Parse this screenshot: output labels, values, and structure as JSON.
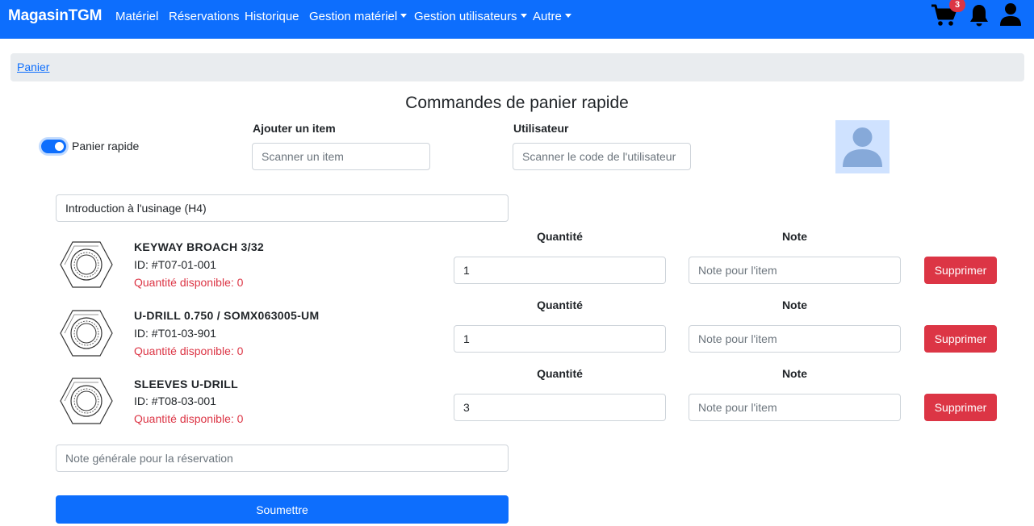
{
  "navbar": {
    "brand": "MagasinTGM",
    "items": [
      {
        "label": "Matériel",
        "dropdown": false
      },
      {
        "label": "Réservations",
        "dropdown": false
      },
      {
        "label": "Historique",
        "dropdown": false
      },
      {
        "label": "Gestion matériel",
        "dropdown": true
      },
      {
        "label": "Gestion utilisateurs",
        "dropdown": true
      },
      {
        "label": "Autre",
        "dropdown": true
      }
    ],
    "cart_count": "3",
    "icons": [
      "cart-icon",
      "bell-icon",
      "user-icon"
    ]
  },
  "breadcrumb": {
    "label": "Panier"
  },
  "page_title": "Commandes de panier rapide",
  "quick_cart": {
    "toggle_label": "Panier rapide",
    "toggle_on": true,
    "add_item_label": "Ajouter un item",
    "add_item_placeholder": "Scanner un item",
    "user_label": "Utilisateur",
    "user_placeholder": "Scanner le code de l'utilisateur"
  },
  "course": {
    "value": "Introduction à l'usinage (H4)"
  },
  "items": [
    {
      "name": "KEYWAY BROACH 3/32",
      "id": "ID: #T07-01-001",
      "available": "Quantité disponible: 0",
      "quantity_label": "Quantité",
      "quantity": "1",
      "note_label": "Note",
      "note_placeholder": "Note pour l'item",
      "delete_label": "Supprimer"
    },
    {
      "name": "U-DRILL 0.750 / SOMX063005-UM",
      "id": "ID: #T01-03-901",
      "available": "Quantité disponible: 0",
      "quantity_label": "Quantité",
      "quantity": "1",
      "note_label": "Note",
      "note_placeholder": "Note pour l'item",
      "delete_label": "Supprimer"
    },
    {
      "name": "SLEEVES U-DRILL",
      "id": "ID: #T08-03-001",
      "available": "Quantité disponible: 0",
      "quantity_label": "Quantité",
      "quantity": "3",
      "note_label": "Note",
      "note_placeholder": "Note pour l'item",
      "delete_label": "Supprimer"
    }
  ],
  "general_note": {
    "placeholder": "Note générale pour la réservation"
  },
  "submit": {
    "label": "Soumettre"
  },
  "colors": {
    "primary": "#0d6efd",
    "danger": "#dc3545",
    "breadcrumb_bg": "#e9ecef",
    "avatar_bg": "#cfe2ff",
    "avatar_fg": "#86a9d9"
  }
}
